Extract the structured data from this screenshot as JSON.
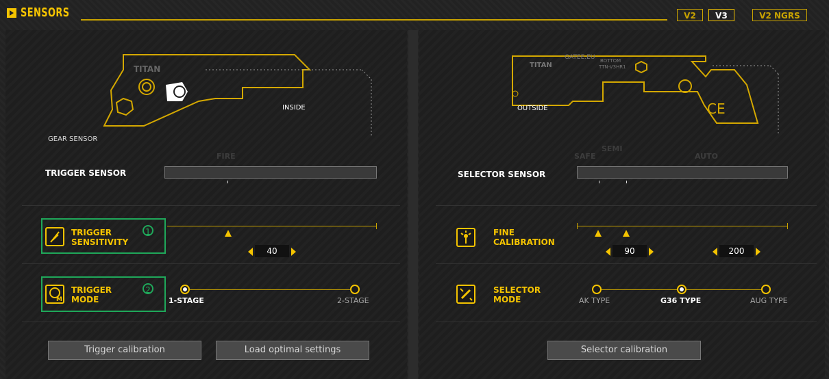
{
  "header": {
    "title": "SENSORS",
    "versions": [
      "V2",
      "V3",
      "V2 NGRS"
    ],
    "active_version": "V3"
  },
  "left": {
    "gun_brand": "TITAN",
    "inside_label": "INSIDE",
    "gear_sensor_label": "GEAR SENSOR",
    "fire_label": "FIRE",
    "trigger_sensor_label": "TRIGGER SENSOR",
    "sensitivity": {
      "label_line1": "TRIGGER",
      "label_line2": "SENSITIVITY",
      "badge": "1",
      "value": "40",
      "icon": "feather-icon"
    },
    "mode": {
      "label_line1": "TRIGGER",
      "label_line2": "MODE",
      "badge": "2",
      "icon": "trigger-mode-icon",
      "options": [
        "1-STAGE",
        "2-STAGE"
      ],
      "selected": "1-STAGE"
    },
    "buttons": {
      "trigger_calibration": "Trigger calibration",
      "load_optimal": "Load optimal settings"
    }
  },
  "right": {
    "gun_brand": "TITAN",
    "gun_site": "GATEE.EU",
    "gun_bottom": "BOTTOM",
    "gun_model": "TTN-V3HR1",
    "outside_label": "OUTSIDE",
    "safe_label": "SAFE",
    "semi_label": "SEMI",
    "auto_label": "AUTO",
    "selector_sensor_label": "SELECTOR SENSOR",
    "fine": {
      "label_line1": "FINE",
      "label_line2": "CALIBRATION",
      "value1": "90",
      "value2": "200",
      "icon": "fine-calibration-icon"
    },
    "selector_mode": {
      "label_line1": "SELECTOR",
      "label_line2": "MODE",
      "icon": "selector-mode-icon",
      "options": [
        "AK TYPE",
        "G36 TYPE",
        "AUG TYPE"
      ],
      "selected": "G36 TYPE"
    },
    "buttons": {
      "selector_calibration": "Selector calibration"
    }
  },
  "colors": {
    "accent": "#f5c400",
    "green": "#1fa85a",
    "panel": "#1e1e1e"
  }
}
